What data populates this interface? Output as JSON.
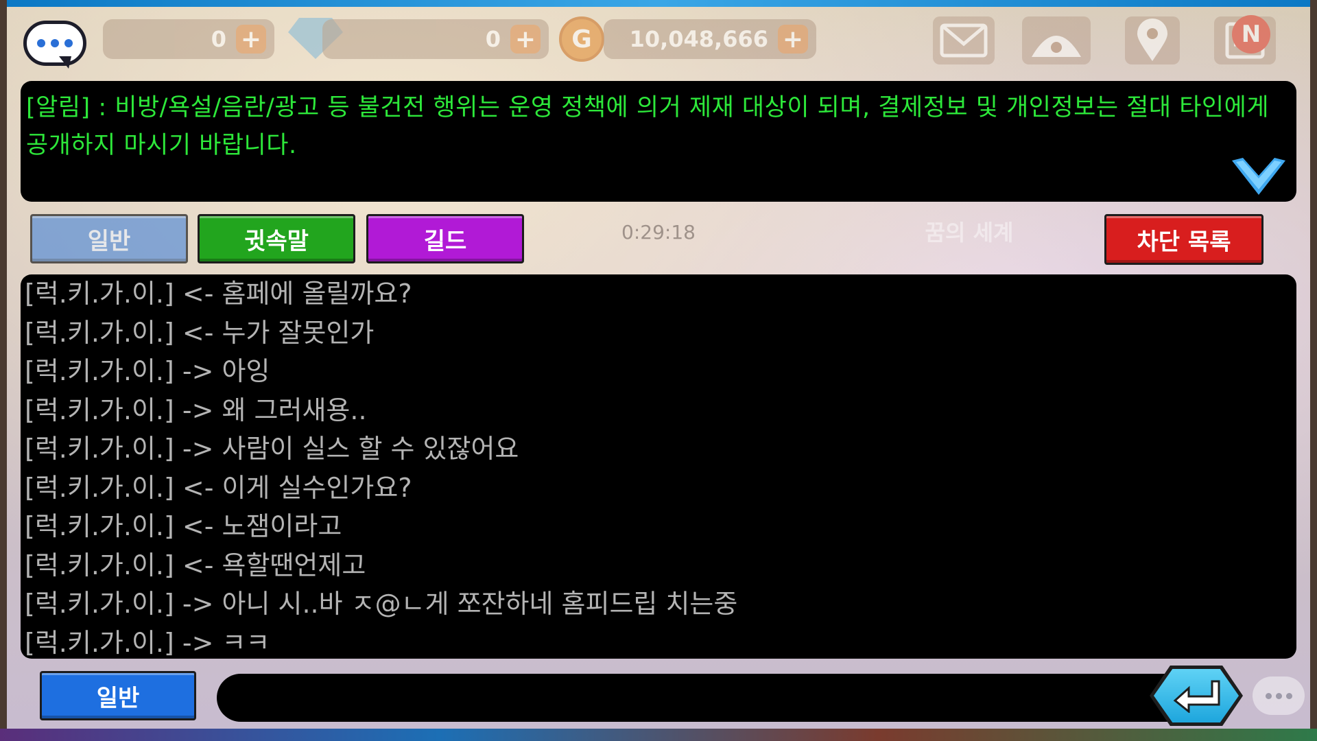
{
  "hud": {
    "currency_1": "0",
    "currency_2": "0",
    "gold": "10,048,666",
    "plus_label": "+",
    "coin_symbol": "G",
    "notification_badge": "N",
    "icons": [
      "mail-icon",
      "pet-house-icon",
      "location-pin-icon",
      "quest-list-icon"
    ]
  },
  "notice": {
    "text": "[알림] : 비방/욕설/음란/광고 등 불건전 행위는 운영 정책에 의거 제재 대상이 되며, 결제정보 및 개인정보는 절대 타인에게 공개하지 마시기 바랍니다."
  },
  "tabs": {
    "general": "일반",
    "whisper": "귓속말",
    "guild": "길드"
  },
  "timer": "0:29:18",
  "world_name": "꿈의 세계",
  "block_list_label": "차단 목록",
  "chat_lines": [
    "[럭.키.가.이.] <- 홈페에 올릴까요?",
    "[럭.키.가.이.] <- 누가 잘못인가",
    "[럭.키.가.이.] -> 아잉",
    "[럭.키.가.이.] -> 왜 그러새용..",
    "[럭.키.가.이.] -> 사람이 실스 할 수 있잖어요",
    "[럭.키.가.이.] <- 이게 실수인가요?",
    "[럭.키.가.이.] <- 노잼이라고",
    "[럭.키.가.이.] <- 욕할땐언제고",
    "[럭.키.가.이.] -> 아니 시..바 ㅈ@ㄴ게 쪼잔하네 홈피드립 치는중",
    "[럭.키.가.이.] -> ㅋㅋ"
  ],
  "input": {
    "channel": "일반",
    "value": "",
    "placeholder": ""
  },
  "colors": {
    "notice_text": "#2de83a",
    "chat_text": "#b4b4b4",
    "whisper_tab": "#22a51e",
    "guild_tab": "#b11ad6",
    "block_button": "#d81e1e",
    "channel_button": "#1e6fe0",
    "send_button": "#1ea6dd"
  }
}
